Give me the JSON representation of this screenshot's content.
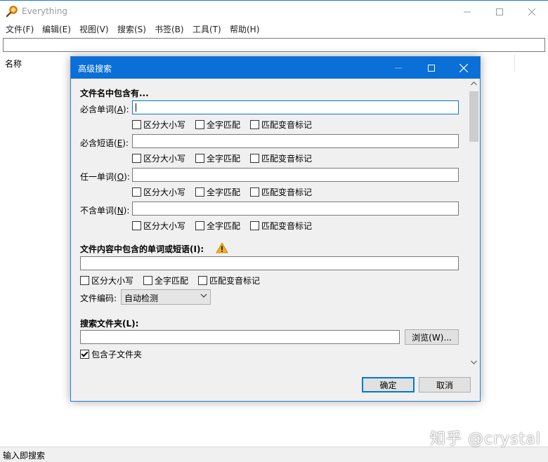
{
  "app": {
    "title": "Everything",
    "menu": [
      "文件(F)",
      "编辑(E)",
      "视图(V)",
      "搜索(S)",
      "书签(B)",
      "工具(T)",
      "帮助(H)"
    ],
    "search_value": "",
    "column_name": "名称",
    "status_text": "输入即搜索",
    "watermark": "知乎 @crystal"
  },
  "dialog": {
    "title": "高级搜索",
    "filename_section": "文件名中包含有...",
    "rows": [
      {
        "label": "必含单词(",
        "key": "A",
        "suffix": "):",
        "value": ""
      },
      {
        "label": "必含短语(",
        "key": "E",
        "suffix": "):",
        "value": ""
      },
      {
        "label": "任一单词(",
        "key": "O",
        "suffix": "):",
        "value": ""
      },
      {
        "label": "不含单词(",
        "key": "N",
        "suffix": "):",
        "value": ""
      }
    ],
    "opt_case": "区分大小写",
    "opt_whole": "全字匹配",
    "opt_diacritics": "匹配变音标记",
    "content_section": "文件内容中包含的单词或短语(I):",
    "content_value": "",
    "encoding_label": "文件编码:",
    "encoding_value": "自动检测",
    "folder_section": "搜索文件夹(L):",
    "folder_value": "",
    "browse_button": "浏览(W)...",
    "include_subfolders": "包含子文件夹",
    "include_subfolders_checked": true,
    "ok_button": "确定",
    "cancel_button": "取消"
  },
  "colors": {
    "accent": "#0a6fd6",
    "dialog_bg": "#f0f0f0",
    "warning": "#f2b01e"
  }
}
